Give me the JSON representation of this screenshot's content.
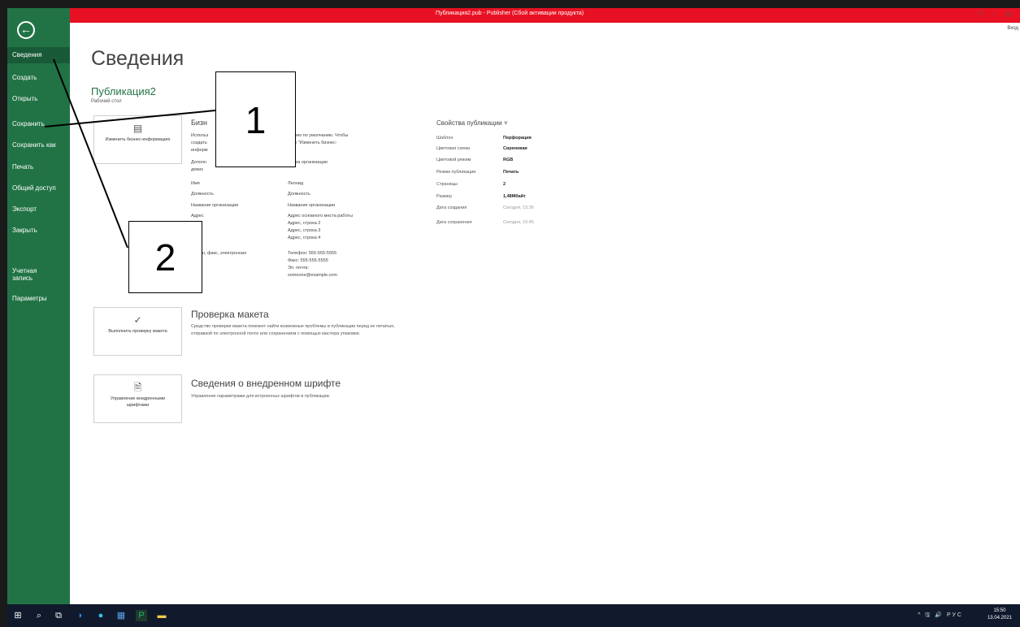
{
  "titlebar": {
    "title": "Публикация2.pub - Publisher (Сбой активации продукта)",
    "controls": "? – ⊡",
    "signin": "Вход"
  },
  "sidebar": {
    "back_icon": "back-arrow-icon",
    "items": [
      {
        "label": "Сведения",
        "active": true
      },
      {
        "label": "Создать"
      },
      {
        "label": "Открыть"
      },
      {
        "label": "Сохранить"
      },
      {
        "label": "Сохранить как"
      },
      {
        "label": "Печать"
      },
      {
        "label": "Общий доступ"
      },
      {
        "label": "Экспорт"
      },
      {
        "label": "Закрыть"
      },
      {
        "label": "Учетная запись"
      },
      {
        "label": "Параметры"
      }
    ]
  },
  "main": {
    "title": "Сведения",
    "pub_name": "Публикация2",
    "pub_path": "Рабочий стол",
    "business": {
      "button_label": "Изменить бизнес-информацию",
      "title": "Бизн",
      "desc_left_1": "Использ",
      "desc_left_2": "создать",
      "desc_left_3": "информ",
      "desc_right_1": "мацию по умолчанию. Чтобы",
      "desc_right_2": "ноку \"Изменить бизнес-",
      "rows": [
        {
          "k": "Дополн",
          "v": "Девиз организации"
        },
        {
          "k": "девиз",
          "v": ""
        },
        {
          "k": "Имя",
          "v": "Леонид"
        },
        {
          "k": "Должность",
          "v": "Должность"
        },
        {
          "k": "Название организации",
          "v": "Название организации"
        },
        {
          "k": "Адрес",
          "v": "Адрес основного места работы"
        },
        {
          "k": "",
          "v": "Адрес, строка 2"
        },
        {
          "k": "",
          "v": "Адрес, строка 3"
        },
        {
          "k": "",
          "v": "Адрес, строка 4"
        },
        {
          "k": "лефон, факс, электронная",
          "v": "Телефон: 555-555-5555"
        },
        {
          "k": "та",
          "v": "Факс: 555-555-5555"
        },
        {
          "k": "",
          "v": "Эл. почта:"
        },
        {
          "k": "",
          "v": "someone@example.com"
        }
      ]
    },
    "check": {
      "button_label": "Выполнить проверку макета",
      "title": "Проверка макета",
      "desc": "Средство проверки макета поможет найти возможные проблемы в публикации перед ее печатью, отправкой по электронной почте или сохранением с помощью мастера упаковки."
    },
    "fonts": {
      "button_label": "Управление внедренными шрифтами",
      "title": "Сведения о внедренном шрифте",
      "desc": "Управление параметрами для встроенных шрифтов в публикации."
    },
    "properties": {
      "title": "Свойства публикации ˅",
      "rows": [
        {
          "k": "Шаблон",
          "v": "Перфорация"
        },
        {
          "k": "Цветовая схема",
          "v": "Сиреневая"
        },
        {
          "k": "Цветовой режим",
          "v": "RGB"
        },
        {
          "k": "Режим публикации",
          "v": "Печать"
        },
        {
          "k": "Страницы",
          "v": "2"
        },
        {
          "k": "Размер",
          "v": "1,48Мбайт"
        },
        {
          "k": "Дата создания",
          "v": "Сегодня, 15:36",
          "muted": true
        },
        {
          "k": "Дата сохранения",
          "v": "Сегодня, 15:45",
          "muted": true
        }
      ]
    }
  },
  "callouts": {
    "one": "1",
    "two": "2"
  },
  "taskbar": {
    "tray": "^ 🖫 🔊 РУС",
    "time": "15:50",
    "date": "13.04.2021"
  }
}
